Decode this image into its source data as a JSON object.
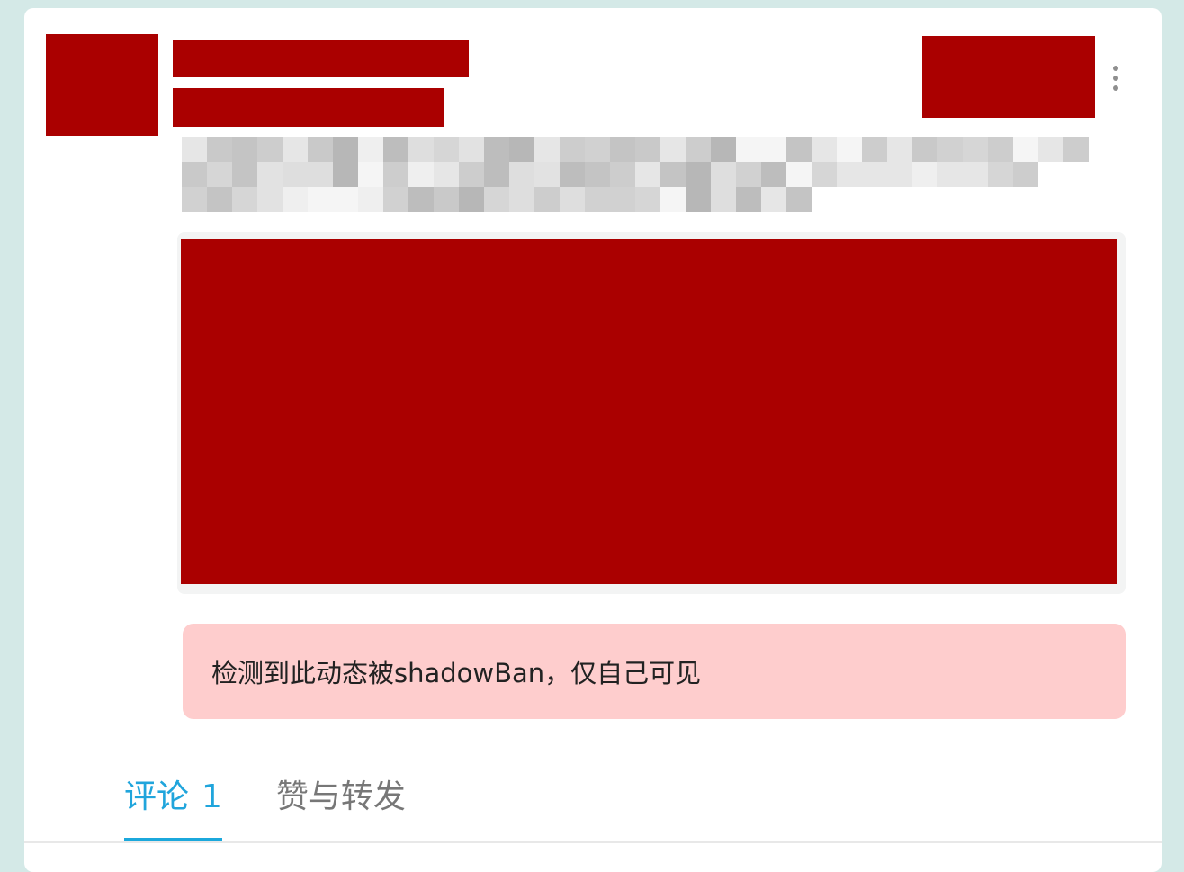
{
  "notice": {
    "message": "检测到此动态被shadowBan，仅自己可见"
  },
  "tabs": [
    {
      "label": "评论",
      "count": "1",
      "active": true
    },
    {
      "label": "赞与转发",
      "active": false
    }
  ],
  "colors": {
    "background": "#d4e9e7",
    "redaction": "#aa0000",
    "notice_background": "#fecdcd",
    "tab_active": "#20a5dc",
    "tab_inactive": "#777777"
  },
  "icons": {
    "more": "more-vertical-icon"
  }
}
